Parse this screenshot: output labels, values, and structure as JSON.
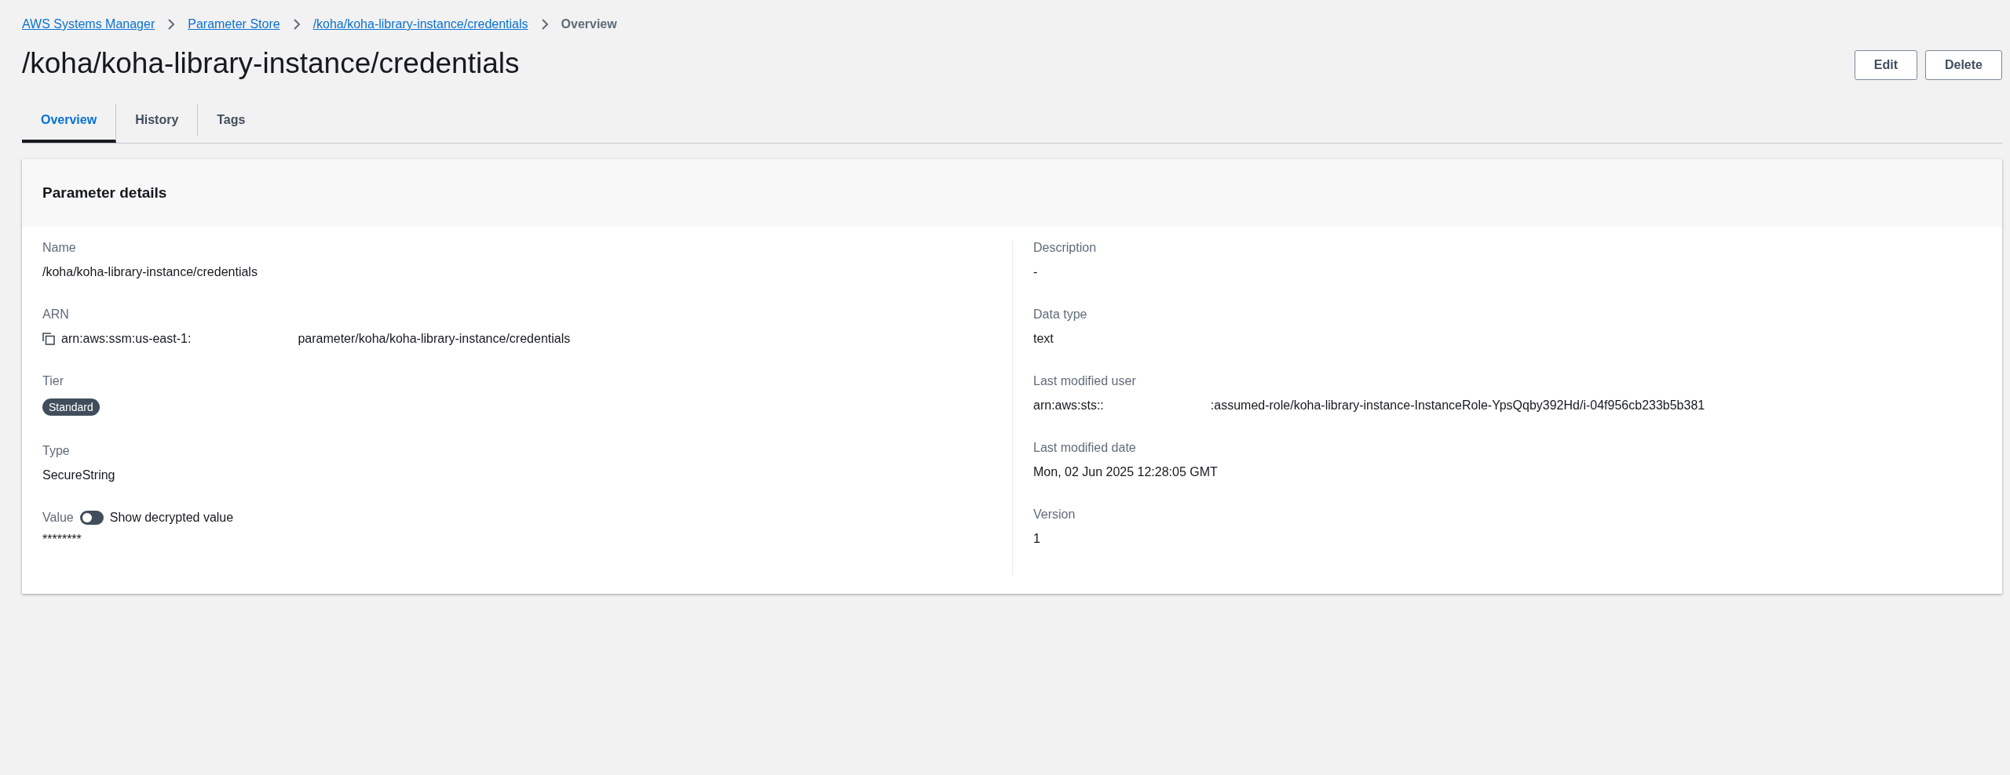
{
  "breadcrumbs": [
    {
      "label": "AWS Systems Manager",
      "link": true
    },
    {
      "label": "Parameter Store",
      "link": true
    },
    {
      "label": "/koha/koha-library-instance/credentials",
      "link": true
    },
    {
      "label": "Overview",
      "link": false
    }
  ],
  "title": "/koha/koha-library-instance/credentials",
  "buttons": [
    "Edit",
    "Delete"
  ],
  "tabs": [
    {
      "label": "Overview",
      "selected": true
    },
    {
      "label": "History",
      "selected": false
    },
    {
      "label": "Tags",
      "selected": false
    }
  ],
  "panel": {
    "title": "Parameter details",
    "left": [
      {
        "kind": "text",
        "label": "Name",
        "value": "/koha/koha-library-instance/credentials"
      },
      {
        "kind": "split",
        "label": "ARN",
        "copy": true,
        "value_start": "arn:aws:ssm:us-east-1:",
        "value_end": "parameter/koha/koha-library-instance/credentials"
      },
      {
        "kind": "badge",
        "label": "Tier",
        "value": "Standard"
      },
      {
        "kind": "text",
        "label": "Type",
        "value": "SecureString"
      },
      {
        "kind": "toggle",
        "label": "Value",
        "toggle_label": "Show decrypted value",
        "on": false,
        "value": "********"
      }
    ],
    "right": [
      {
        "kind": "text",
        "label": "Description",
        "value": "-"
      },
      {
        "kind": "text",
        "label": "Data type",
        "value": "text"
      },
      {
        "kind": "split",
        "label": "Last modified user",
        "copy": false,
        "value_start": "arn:aws:sts::",
        "value_end": ":assumed-role/koha-library-instance-InstanceRole-YpsQqby392Hd/i-04f956cb233b5b381"
      },
      {
        "kind": "text",
        "label": "Last modified date",
        "value": "Mon, 02 Jun 2025 12:28:05 GMT"
      },
      {
        "kind": "text",
        "label": "Version",
        "value": "1"
      }
    ]
  }
}
